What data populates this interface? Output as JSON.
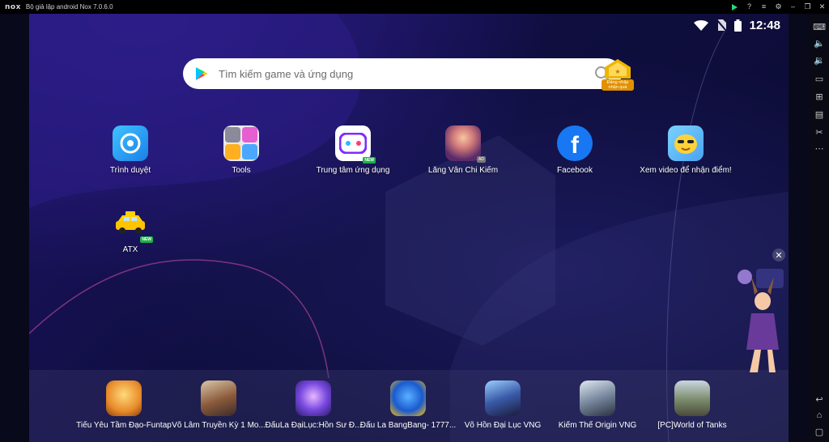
{
  "window": {
    "logo": "nox",
    "title": "Bộ giả lập android Nox 7.0.6.0"
  },
  "status_bar": {
    "time": "12:48"
  },
  "search": {
    "placeholder": "Tìm kiếm game và ứng dụng"
  },
  "login_badge": {
    "label": "Đăng nhập nhận quà"
  },
  "apps": [
    {
      "label": "Trình duyệt",
      "icon": "browser-icon"
    },
    {
      "label": "Tools",
      "icon": "tools-icon"
    },
    {
      "label": "Trung tâm ứng dụng",
      "icon": "app-center-icon",
      "badge": "NEW"
    },
    {
      "label": "Lăng Vân Chi Kiếm",
      "icon": "lang-van-chi-kiem-icon",
      "badge": "AD"
    },
    {
      "label": "Facebook",
      "icon": "facebook-icon"
    },
    {
      "label": "Xem video để nhận điểm!",
      "icon": "watch-video-icon"
    },
    {
      "label": "ATX",
      "icon": "atx-taxi-icon",
      "badge": "NEW"
    }
  ],
  "dock": [
    {
      "label": "Tiểu Yêu Tầm Đạo-Funtap",
      "icon": "tieu-yeu-tam-dao-icon"
    },
    {
      "label": "Võ Lâm Truyền Kỳ 1 Mo...",
      "icon": "vo-lam-truyen-ky-icon"
    },
    {
      "label": "ĐấuLa ĐạiLục:Hồn Sư Đ...",
      "icon": "dau-la-dai-luc-icon"
    },
    {
      "label": "Đấu La BangBang- 1777...",
      "icon": "dau-la-bangbang-icon"
    },
    {
      "label": "Võ Hồn Đại Lục VNG",
      "icon": "vo-hon-dai-luc-icon"
    },
    {
      "label": "Kiếm Thế Origin VNG",
      "icon": "kiem-the-origin-icon"
    },
    {
      "label": "[PC]World of Tanks",
      "icon": "world-of-tanks-icon"
    }
  ],
  "colors": {
    "accent_green": "#2bd77d",
    "facebook_blue": "#1877f2",
    "background": "#0f0e3f"
  }
}
